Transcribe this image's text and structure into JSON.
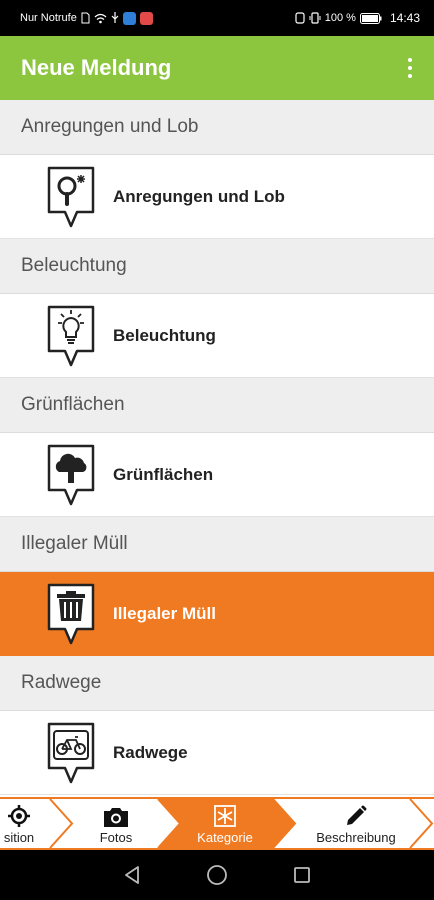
{
  "status_bar": {
    "carrier": "Nur Notrufe",
    "battery": "100 %",
    "time": "14:43"
  },
  "app_bar": {
    "title": "Neue Meldung",
    "menu_icon": "overflow-menu-icon"
  },
  "categories": [
    {
      "header": "Anregungen und Lob",
      "label": "Anregungen und Lob",
      "icon": "magnifier-star-icon",
      "selected": false
    },
    {
      "header": "Beleuchtung",
      "label": "Beleuchtung",
      "icon": "lightbulb-icon",
      "selected": false
    },
    {
      "header": "Grünflächen",
      "label": "Grünflächen",
      "icon": "tree-icon",
      "selected": false
    },
    {
      "header": "Illegaler Müll",
      "label": "Illegaler Müll",
      "icon": "trash-bin-icon",
      "selected": true
    },
    {
      "header": "Radwege",
      "label": "Radwege",
      "icon": "bicycle-icon",
      "selected": false
    }
  ],
  "steps": [
    {
      "label": "Position",
      "visible_label": "sition",
      "icon": "location-target-icon",
      "active": false
    },
    {
      "label": "Fotos",
      "icon": "camera-icon",
      "active": false
    },
    {
      "label": "Kategorie",
      "icon": "category-snowflake-icon",
      "active": true
    },
    {
      "label": "Beschreibung",
      "icon": "pencil-icon",
      "active": false
    }
  ],
  "colors": {
    "app_bar": "#8cc63f",
    "accent": "#f07a22",
    "section_bg": "#eeeeee"
  }
}
